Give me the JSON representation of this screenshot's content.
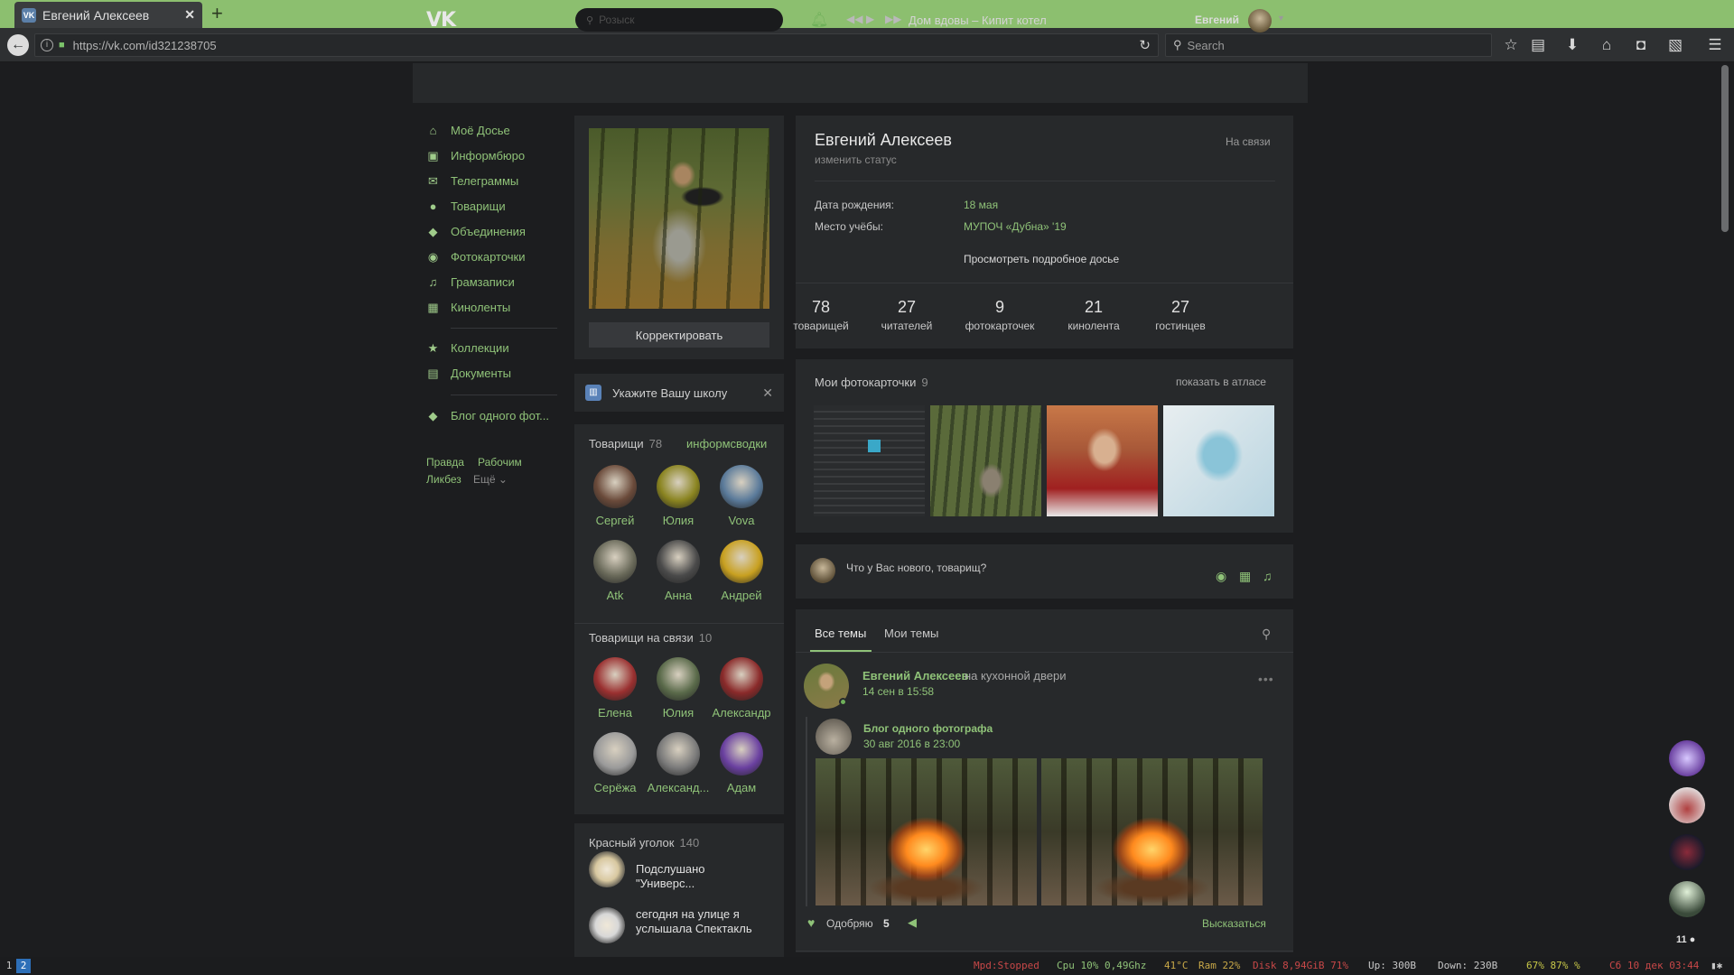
{
  "browser": {
    "tab_title": "Евгений Алексеев",
    "tab_favicon": "VK",
    "url": "https://vk.com/id321238705",
    "search_placeholder": "Search",
    "accent": "#8cbf6f"
  },
  "header": {
    "logo": "VK",
    "search_placeholder": "Розыск",
    "track": "Дом вдовы – Кипит котел",
    "user": "Евгений"
  },
  "menu": {
    "items": [
      {
        "icon": "home-icon",
        "glyph": "⌂",
        "label": "Моё Досье"
      },
      {
        "icon": "news-icon",
        "glyph": "▣",
        "label": "Информбюро"
      },
      {
        "icon": "messages-icon",
        "glyph": "✉",
        "label": "Телеграммы"
      },
      {
        "icon": "friends-icon",
        "glyph": "●",
        "label": "Товарищи"
      },
      {
        "icon": "groups-icon",
        "glyph": "◆",
        "label": "Объединения"
      },
      {
        "icon": "camera-icon",
        "glyph": "◉",
        "label": "Фотокарточки"
      },
      {
        "icon": "music-icon",
        "glyph": "♫",
        "label": "Грамзаписи"
      },
      {
        "icon": "video-icon",
        "glyph": "▦",
        "label": "Киноленты"
      },
      {
        "icon": "star-icon",
        "glyph": "★",
        "label": "Коллекции"
      },
      {
        "icon": "document-icon",
        "glyph": "▤",
        "label": "Документы"
      },
      {
        "icon": "group-icon",
        "glyph": "◆",
        "label": "Блог одного фот..."
      }
    ],
    "footer": {
      "pravda": "Правда",
      "work": "Рабочим",
      "likbez": "Ликбез",
      "more": "Ещё ⌄"
    }
  },
  "profile": {
    "edit_button": "Корректировать",
    "school_prompt": "Укажите Вашу школу",
    "name": "Евгений Алексеев",
    "status": "изменить статус",
    "online": "На связи",
    "birthday_label": "Дата рождения:",
    "birthday": "18 мая",
    "study_label": "Место учёбы:",
    "study": "МУПОЧ «Дубна» '19",
    "more": "Просмотреть подробное досье",
    "stats": [
      {
        "value": "78",
        "label": "товарищей"
      },
      {
        "value": "27",
        "label": "читателей"
      },
      {
        "value": "9",
        "label": "фотокарточек"
      },
      {
        "value": "21",
        "label": "кинолента"
      },
      {
        "value": "27",
        "label": "гостинцев"
      }
    ]
  },
  "friends": {
    "title": "Товарищи",
    "count": "78",
    "link": "информсводки",
    "items": [
      {
        "name": "Сергей",
        "color": "#6a4a3a"
      },
      {
        "name": "Юлия",
        "color": "#8a8420"
      },
      {
        "name": "Vova",
        "color": "#5a7a9a"
      },
      {
        "name": "Atk",
        "color": "#6a6a5a"
      },
      {
        "name": "Анна",
        "color": "#4a4a4a"
      },
      {
        "name": "Андрей",
        "color": "#c8a020"
      }
    ]
  },
  "online_friends": {
    "title": "Товарищи на связи",
    "count": "10",
    "items": [
      {
        "name": "Елена",
        "color": "#9a3030"
      },
      {
        "name": "Юлия",
        "color": "#5a6a4a"
      },
      {
        "name": "Александр",
        "color": "#8a2a2a"
      },
      {
        "name": "Серёжа",
        "color": "#9a9a9a"
      },
      {
        "name": "Александ...",
        "color": "#7a7a7a"
      },
      {
        "name": "Адам",
        "color": "#6a40a0"
      }
    ]
  },
  "groups": {
    "title": "Красный уголок",
    "count": "140",
    "items": [
      {
        "name": "Подслушано \"Универс...",
        "color": "#d8c8a0"
      },
      {
        "name": "сегодня на улице я услышала Спектакль",
        "color": "#d8d8d8"
      }
    ]
  },
  "photos": {
    "title": "Мои фотокарточки",
    "count": "9",
    "link": "показать в атласе"
  },
  "composer": {
    "placeholder": "Что у Вас нового, товарищ?"
  },
  "feed": {
    "tab_all": "Все темы",
    "tab_mine": "Мои темы",
    "post": {
      "author": "Евгений Алексеев",
      "where": "на кухонной двери",
      "date": "14 сен в 15:58",
      "repost_author": "Блог одного фотографа",
      "repost_date": "30 авг 2016 в 23:00",
      "like_label": "Одобряю",
      "like_count": "5",
      "comment": "Высказаться"
    }
  },
  "sidebar_right": {
    "count": "11 ●"
  },
  "statusbar": {
    "ws1": "1",
    "ws2": "2",
    "mpd": "Mpd:Stopped",
    "cpu": "Cpu 10% 0,49Ghz",
    "temp": "41°C",
    "ram": "Ram 22%",
    "disk": "Disk 8,94GiB 71%",
    "up": "Up: 300B",
    "down": "Down: 230B",
    "pct": "67% 87% %",
    "date": "Сб 10 дек 03:44"
  }
}
